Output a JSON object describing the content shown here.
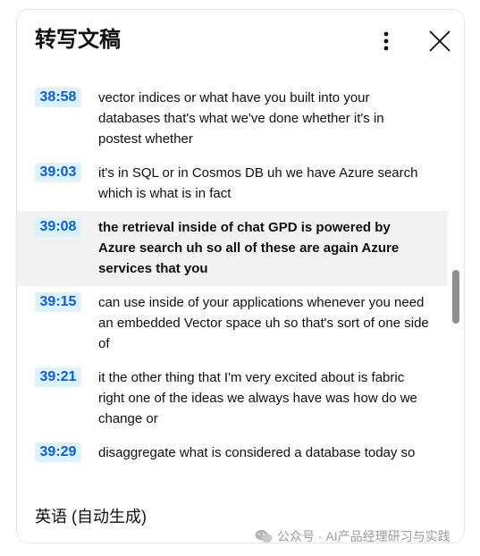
{
  "header": {
    "title": "转写文稿"
  },
  "segments": [
    {
      "time": "38:58",
      "text": "vector indices or what have you built into your databases that's what we've done whether it's in postest whether",
      "active": false
    },
    {
      "time": "39:03",
      "text": "it's in SQL or in Cosmos DB uh we have Azure search which is what is in fact",
      "active": false
    },
    {
      "time": "39:08",
      "text": "the retrieval inside of chat GPD is powered by Azure search uh so all of these are again Azure services that you",
      "active": true
    },
    {
      "time": "39:15",
      "text": "can use inside of your applications whenever you need an embedded Vector space uh so that's sort of one side of",
      "active": false
    },
    {
      "time": "39:21",
      "text": "it the other thing that I'm very excited about is fabric right one of the ideas we always have was how do we change or",
      "active": false
    },
    {
      "time": "39:29",
      "text": "disaggregate what is considered a database today so",
      "active": false
    }
  ],
  "footer": {
    "language": "英语 (自动生成)"
  },
  "watermark": {
    "text": "公众号 · AI产品经理研习与实践"
  },
  "colors": {
    "timestamp_text": "#065fd4",
    "timestamp_bg": "#def1ff",
    "active_row_bg": "#f2f2f2",
    "scrollbar": "#909090"
  },
  "icons": {
    "more": "more-vert-icon",
    "close": "close-icon",
    "watermark": "wechat-icon"
  }
}
